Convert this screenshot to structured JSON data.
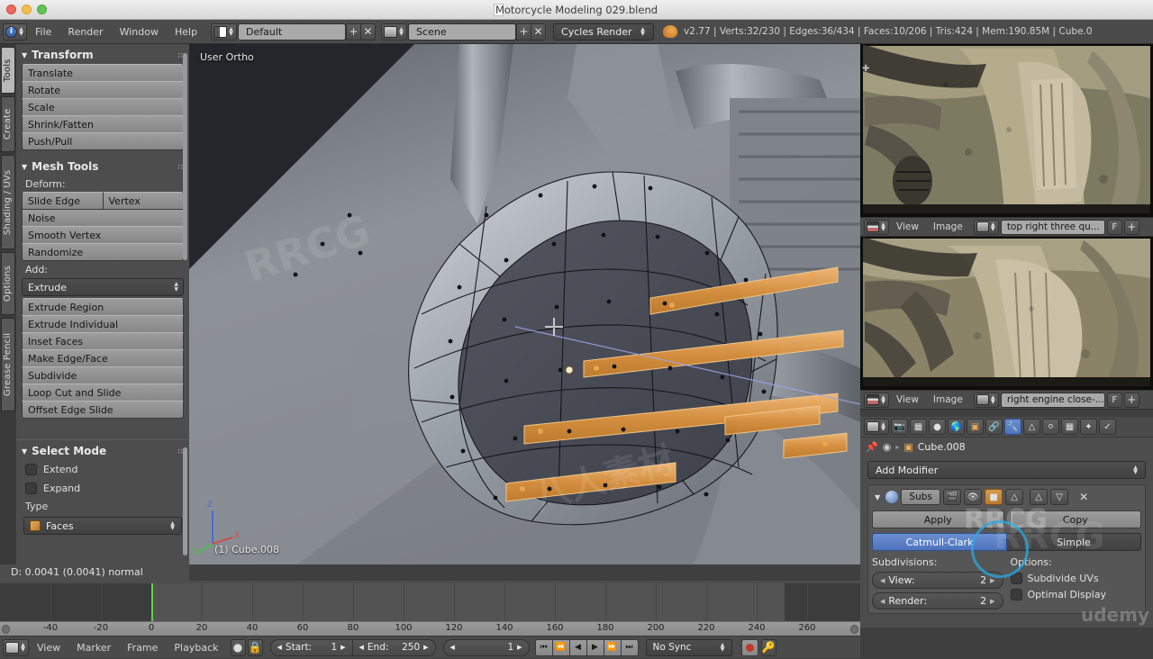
{
  "window": {
    "title": "Motorcycle Modeling 029.blend",
    "controls": [
      "close",
      "minimize",
      "maximize"
    ]
  },
  "topbar": {
    "editor_icon": "info-editor-icon",
    "menus": [
      "File",
      "Render",
      "Window",
      "Help"
    ],
    "screen_layout": {
      "icon": "screen-layout-icon",
      "value": "Default",
      "add": "+",
      "remove": "✕"
    },
    "scene": {
      "icon": "scene-icon",
      "value": "Scene",
      "add": "+",
      "remove": "✕"
    },
    "render_engine": "Cycles Render",
    "status": "v2.77 | Verts:32/230 | Edges:36/434 | Faces:10/206 | Tris:424 | Mem:190.85M | Cube.0"
  },
  "toolshelf": {
    "tabs": [
      "Tools",
      "Create",
      "Shading / UVs",
      "Options",
      "Grease Pencil"
    ],
    "active_tab": "Tools",
    "transform": {
      "title": "Transform",
      "buttons": [
        "Translate",
        "Rotate",
        "Scale",
        "Shrink/Fatten",
        "Push/Pull"
      ]
    },
    "mesh_tools": {
      "title": "Mesh Tools",
      "deform_label": "Deform:",
      "deform_row": [
        "Slide Edge",
        "Vertex"
      ],
      "deform_buttons": [
        "Noise",
        "Smooth Vertex",
        "Randomize"
      ],
      "add_label": "Add:",
      "add_dropdown": "Extrude",
      "add_buttons": [
        "Extrude Region",
        "Extrude Individual",
        "Inset Faces",
        "Make Edge/Face",
        "Subdivide",
        "Loop Cut and Slide",
        "Offset Edge Slide"
      ]
    },
    "select_mode": {
      "title": "Select Mode",
      "checkboxes": [
        "Extend",
        "Expand"
      ],
      "type_label": "Type",
      "type_value": "Faces"
    },
    "status_line": "D: 0.0041 (0.0041) normal"
  },
  "viewport": {
    "view_label": "User Ortho",
    "object_label": "(1) Cube.008",
    "cursor": "crosshair-cursor",
    "axis_gizmo": {
      "z": "Z",
      "y": "Y",
      "x": "X"
    },
    "selection_color": "#e8a64f",
    "mesh_color": "#4a4d57"
  },
  "image_editors": [
    {
      "editor_icon": "image-editor-icon",
      "menus": [
        "View",
        "Image"
      ],
      "browse_icon": "browse-image-icon",
      "image_name": "top right three qu...",
      "fake_user": "F",
      "add_new": "+"
    },
    {
      "editor_icon": "image-editor-icon",
      "menus": [
        "View",
        "Image"
      ],
      "browse_icon": "browse-image-icon",
      "image_name": "right engine close-...",
      "fake_user": "F",
      "add_new": "+"
    }
  ],
  "properties": {
    "editor_icon": "properties-editor-icon",
    "nav_tabs": [
      "render-icon",
      "render-layers-icon",
      "scene-icon",
      "world-icon",
      "object-icon",
      "constraints-icon",
      "modifiers-icon",
      "data-icon",
      "material-icon",
      "texture-icon",
      "particles-icon",
      "physics-icon"
    ],
    "active_nav": "modifiers-icon",
    "breadcrumb": {
      "pin": "pin-icon",
      "scene": "scene-icon",
      "sep": "▸",
      "object_icon": "object-icon",
      "object": "Cube.008"
    },
    "add_modifier": "Add Modifier",
    "modifier": {
      "collapse_icon": "chevron-down-icon",
      "type_icon": "subsurf-icon",
      "name": "Subs",
      "toggle_icons": [
        "render-toggle-icon",
        "viewport-toggle-icon",
        "edit-mode-toggle-icon",
        "on-cage-toggle-icon"
      ],
      "move_up": "△",
      "move_down": "▽",
      "delete": "✕",
      "apply": "Apply",
      "copy": "Copy",
      "algorithms": [
        "Catmull-Clark",
        "Simple"
      ],
      "active_algorithm": "Catmull-Clark",
      "subdivisions_label": "Subdivisions:",
      "options_label": "Options:",
      "view": {
        "label": "View:",
        "value": "2"
      },
      "render": {
        "label": "Render:",
        "value": "2"
      },
      "subdivide_uvs": "Subdivide UVs",
      "optimal_display": "Optimal Display"
    }
  },
  "timeline": {
    "editor_icon": "timeline-editor-icon",
    "menus": [
      "View",
      "Marker",
      "Frame",
      "Playback"
    ],
    "auto_key_icon": "record-auto-key-icon",
    "lock_icon": "lock-icon",
    "start": {
      "label": "Start:",
      "value": "1"
    },
    "end": {
      "label": "End:",
      "value": "250"
    },
    "current_frame": "1",
    "transport": [
      "jump-start-icon",
      "prev-keyframe-icon",
      "play-reverse-icon",
      "play-icon",
      "next-keyframe-icon",
      "jump-end-icon"
    ],
    "sync_mode": "No Sync",
    "record_icon": "record-icon",
    "ruler_ticks": [
      "-40",
      "-20",
      "0",
      "20",
      "40",
      "60",
      "80",
      "100",
      "120",
      "140",
      "160",
      "180",
      "200",
      "220",
      "240",
      "260"
    ],
    "playhead_frame": "0",
    "playhead_color": "#60d14a"
  }
}
